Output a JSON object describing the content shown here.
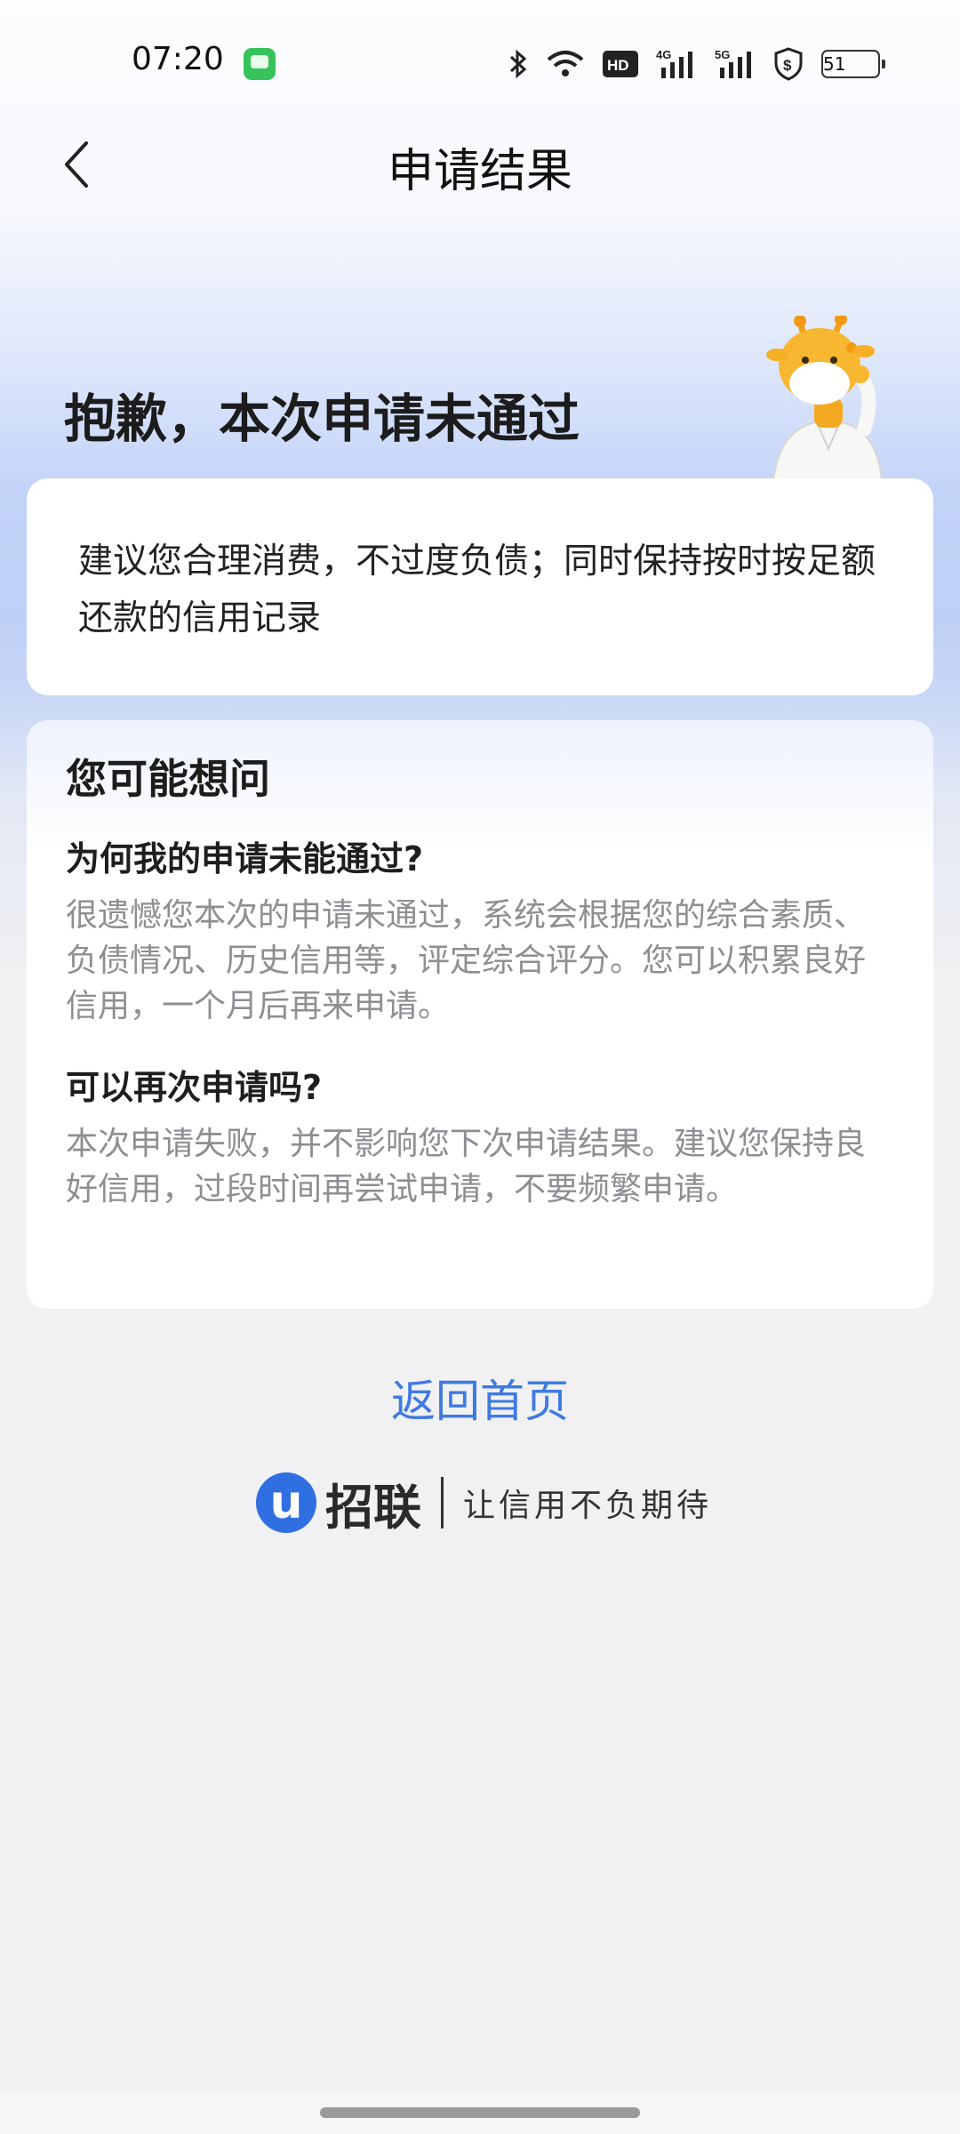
{
  "status_bar": {
    "time": "07:20",
    "battery": "51"
  },
  "header": {
    "title": "申请结果"
  },
  "hero": {
    "title": "抱歉，本次申请未通过"
  },
  "advice": {
    "text": "建议您合理消费，不过度负债；同时保持按时按足额还款的信用记录"
  },
  "faq": {
    "title": "您可能想问",
    "items": [
      {
        "question": "为何我的申请未能通过?",
        "answer": "很遗憾您本次的申请未通过，系统会根据您的综合素质、负债情况、历史信用等，评定综合评分。您可以积累良好信用，一个月后再来申请。"
      },
      {
        "question": "可以再次申请吗?",
        "answer": "本次申请失败，并不影响您下次申请结果。建议您保持良好信用，过段时间再尝试申请，不要频繁申请。"
      }
    ]
  },
  "actions": {
    "back_home": "返回首页"
  },
  "brand": {
    "logo_char": "u",
    "name": "招联",
    "slogan": "让信用不负期待"
  },
  "icons": [
    "messages-app-icon",
    "bluetooth-icon",
    "wifi-icon",
    "hd-icon",
    "signal-4g-icon",
    "signal-5g-icon",
    "shield-dollar-icon",
    "battery-icon",
    "back-arrow-icon",
    "giraffe-mascot"
  ],
  "colors": {
    "accent": "#3f7ae2",
    "brand_blue": "#2f6fe2"
  }
}
